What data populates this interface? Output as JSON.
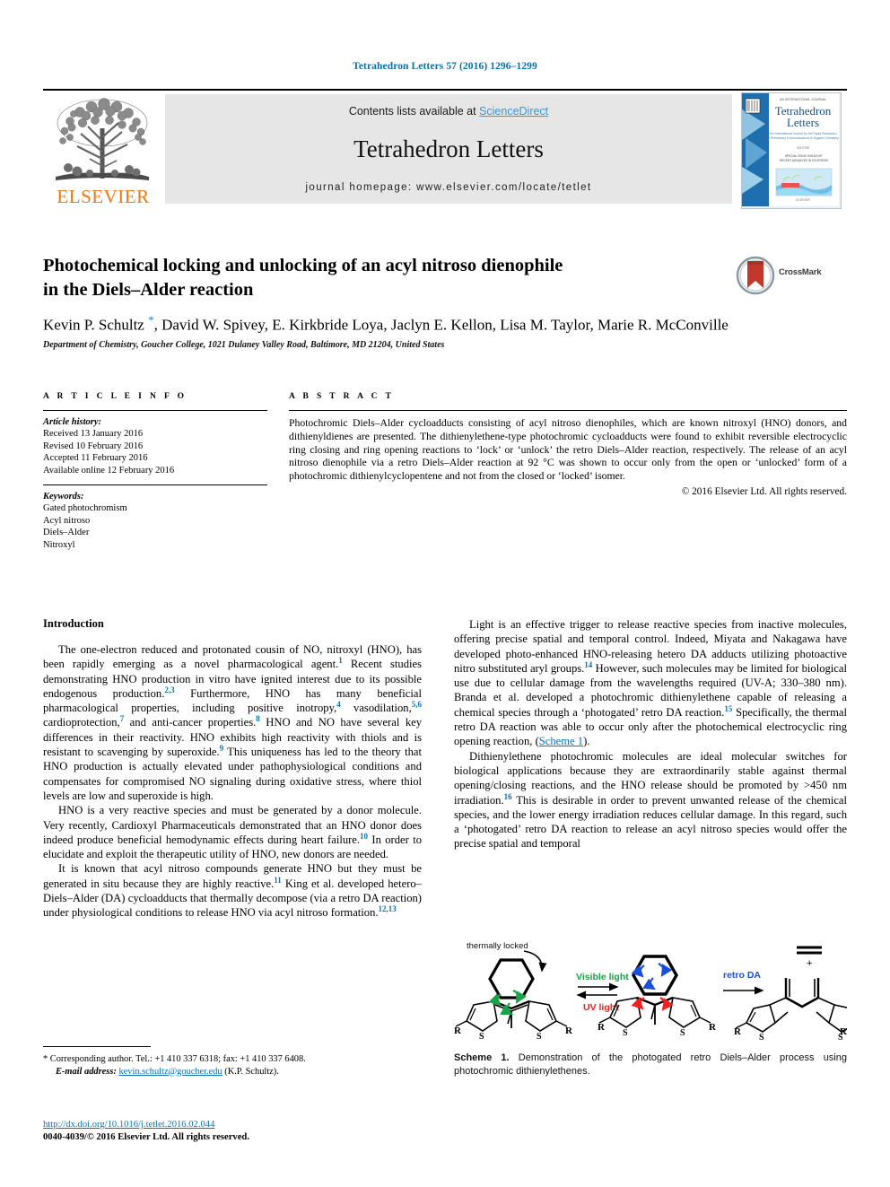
{
  "running_head": "Tetrahedron Letters 57 (2016) 1296–1299",
  "masthead": {
    "contents_prefix": "Contents lists available at ",
    "sciencedirect": "ScienceDirect",
    "journal_title": "Tetrahedron Letters",
    "homepage": "journal homepage: www.elsevier.com/locate/tetlet",
    "publisher_wordmark": "ELSEVIER",
    "publisher_color": "#ee7711",
    "link_color": "#3c97d3",
    "band_color": "#e6e6e6",
    "cover_title_line1": "Tetrahedron",
    "cover_title_line2": "Letters"
  },
  "title": {
    "line1": "Photochemical locking and unlocking of an acyl nitroso dienophile",
    "line2": "in the Diels–Alder reaction",
    "crossmark_label": "CrossMark"
  },
  "authors": {
    "text": "Kevin P. Schultz ",
    "star": "*",
    "rest": ", David W. Spivey, E. Kirkbride Loya, Jaclyn E. Kellon, Lisa M. Taylor, Marie R. McConville",
    "affiliation": "Department of Chemistry, Goucher College, 1021 Dulaney Valley Road, Baltimore, MD 21204, United States"
  },
  "article_info": {
    "heading": "A R T I C L E  I N F O",
    "history_label": "Article history:",
    "history": [
      "Received 13 January 2016",
      "Revised 10 February 2016",
      "Accepted 11 February 2016",
      "Available online 12 February 2016"
    ],
    "keywords_label": "Keywords:",
    "keywords": [
      "Gated photochromism",
      "Acyl nitroso",
      "Diels–Alder",
      "Nitroxyl"
    ]
  },
  "abstract": {
    "heading": "A B S T R A C T",
    "text": "Photochromic Diels–Alder cycloadducts consisting of acyl nitroso dienophiles, which are known nitroxyl (HNO) donors, and dithienyldienes are presented. The dithienylethene-type photochromic cycloadducts were found to exhibit reversible electrocyclic ring closing and ring opening reactions to ‘lock’ or ‘unlock’ the retro Diels–Alder reaction, respectively. The release of an acyl nitroso dienophile via a retro Diels–Alder reaction at 92 °C was shown to occur only from the open or ‘unlocked’ form of a photochromic dithienylcyclopentene and not from the closed or ‘locked’ isomer.",
    "copyright": "© 2016 Elsevier Ltd. All rights reserved."
  },
  "body": {
    "intro_heading": "Introduction",
    "left_p1_a": "The one-electron reduced and protonated cousin of NO, nitroxyl (HNO), has been rapidly emerging as a novel pharmacological agent.",
    "left_p1_r1": "1",
    "left_p1_b": " Recent studies demonstrating HNO production in vitro have ignited interest due to its possible endogenous production.",
    "left_p1_r2": "2,3",
    "left_p1_c": " Furthermore, HNO has many beneficial pharmacological properties, including positive inotropy,",
    "left_p1_r3": "4",
    "left_p1_d": " vasodilation,",
    "left_p1_r4": "5,6",
    "left_p1_e": " cardioprotection,",
    "left_p1_r5": "7",
    "left_p1_f": " and anti-cancer properties.",
    "left_p1_r6": "8",
    "left_p1_g": " HNO and NO have several key differences in their reactivity. HNO exhibits high reactivity with thiols and is resistant to scavenging by superoxide.",
    "left_p1_r7": "9",
    "left_p1_h": " This uniqueness has led to the theory that HNO production is actually elevated under pathophysiological conditions and compensates for compromised NO signaling during oxidative stress, where thiol levels are low and superoxide is high.",
    "left_p2_a": "HNO is a very reactive species and must be generated by a donor molecule. Very recently, Cardioxyl Pharmaceuticals demonstrated that an HNO donor does indeed produce beneficial hemodynamic effects during heart failure.",
    "left_p2_r1": "10",
    "left_p2_b": " In order to elucidate and exploit the therapeutic utility of HNO, new donors are needed.",
    "left_p3_a": "It is known that acyl nitroso compounds generate HNO but they must be generated in situ because they are highly reactive.",
    "left_p3_r1": "11",
    "left_p3_b": " King et al. developed hetero–Diels–Alder (DA) cycloadducts that thermally decompose (via a retro DA reaction) under physiological conditions to release HNO via acyl nitroso formation.",
    "left_p3_r2": "12,13",
    "right_p1_a": "Light is an effective trigger to release reactive species from inactive molecules, offering precise spatial and temporal control. Indeed, Miyata and Nakagawa have developed photo-enhanced HNO-releasing hetero DA adducts utilizing photoactive nitro substituted aryl groups.",
    "right_p1_r1": "14",
    "right_p1_b": " However, such molecules may be limited for biological use due to cellular damage from the wavelengths required (UV-A; 330–380 nm). Branda et al. developed a photochromic dithienylethene capable of releasing a chemical species through a ‘photogated’ retro DA reaction.",
    "right_p1_r2": "15",
    "right_p1_c": " Specifically, the thermal retro DA reaction was able to occur only after the photochemical electrocyclic ring opening reaction, (",
    "right_p1_xref": "Scheme 1",
    "right_p1_d": ").",
    "right_p2_a": "Dithienylethene photochromic molecules are ideal molecular switches for biological applications because they are extraordinarily stable against thermal opening/closing reactions, and the HNO release should be promoted by >450 nm irradiation.",
    "right_p2_r1": "16",
    "right_p2_b": " This is desirable in order to prevent unwanted release of the chemical species, and the lower energy irradiation reduces cellular damage. In this regard, such a ‘photogated’ retro DA reaction to release an acyl nitroso species would offer the precise spatial and temporal"
  },
  "scheme": {
    "label_thermally_locked": "thermally locked",
    "label_visible_light": "Visible light",
    "label_uv_light": "UV light",
    "label_retro_da": "retro DA",
    "label_plus": "+",
    "atom_R": "R",
    "atom_S": "S",
    "visible_light_color": "#18a349",
    "uv_light_color": "#ee2222",
    "retro_da_color": "#1b4fd8",
    "caption_bold": "Scheme 1.",
    "caption_text": " Demonstration of the photogated retro Diels–Alder process using photochromic dithienylethenes."
  },
  "footnote": {
    "star": "*",
    "corresponding": " Corresponding author. Tel.: +1 410 337 6318; fax: +1 410 337 6408.",
    "email_label": "E-mail address:",
    "email": "kevin.schultz@goucher.edu",
    "email_suffix": " (K.P. Schultz).",
    "doi": "http://dx.doi.org/10.1016/j.tetlet.2016.02.044",
    "issn_line": "0040-4039/© 2016 Elsevier Ltd. All rights reserved."
  }
}
